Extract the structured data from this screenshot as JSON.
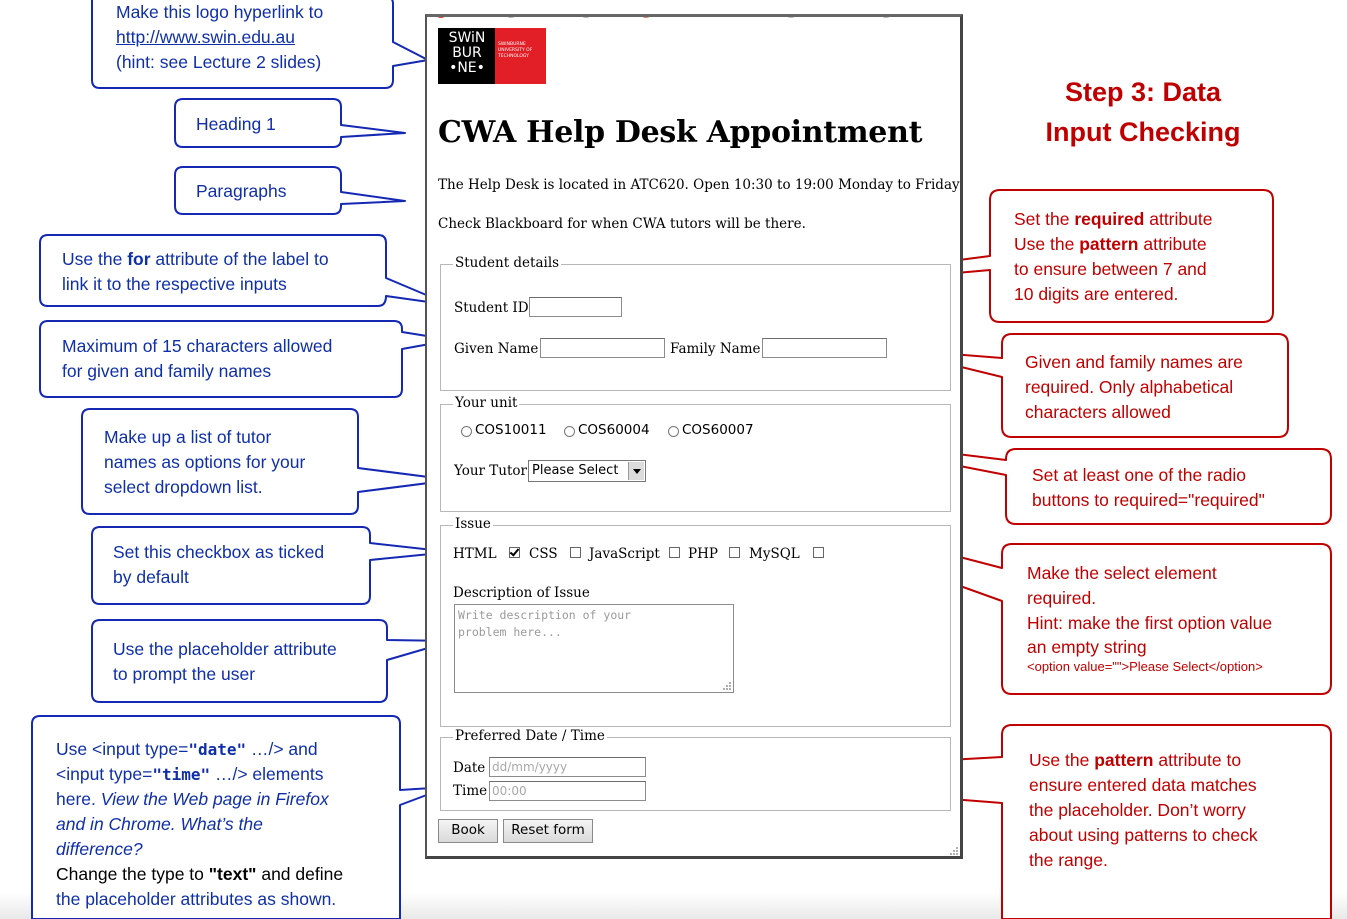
{
  "browser": {
    "logo": {
      "line1": "SWiN",
      "line2": "BUR",
      "line3": "•NE•",
      "university": [
        "SWINBURNE",
        "UNIVERSITY OF",
        "TECHNOLOGY"
      ]
    },
    "heading": "CWA Help Desk Appointment",
    "paragraph1": "The Help Desk is located in ATC620. Open 10:30 to 19:00 Monday to Friday",
    "paragraph2": "Check Blackboard for when CWA tutors will be there.",
    "student_details": {
      "legend": "Student details",
      "student_id_label": "Student ID",
      "student_id_value": "",
      "given_name_label": "Given Name",
      "given_name_value": "",
      "family_name_label": "Family Name",
      "family_name_value": ""
    },
    "your_unit": {
      "legend": "Your unit",
      "radios": [
        "COS10011",
        "COS60004",
        "COS60007"
      ],
      "tutor_label": "Your Tutor",
      "tutor_selected": "Please Select"
    },
    "issue": {
      "legend": "Issue",
      "checkboxes": [
        {
          "label": "HTML",
          "checked": true
        },
        {
          "label": "CSS",
          "checked": false
        },
        {
          "label": "JavaScript",
          "checked": false
        },
        {
          "label": "PHP",
          "checked": false
        },
        {
          "label": "MySQL",
          "checked": false
        }
      ],
      "description_label": "Description of Issue",
      "description_placeholder": "Write description of your\nproblem here..."
    },
    "preferred": {
      "legend": "Preferred Date / Time",
      "date_label": "Date",
      "date_placeholder": "dd/mm/yyyy",
      "time_label": "Time",
      "time_placeholder": "00:00"
    },
    "buttons": {
      "book": "Book",
      "reset": "Reset form"
    }
  },
  "step_title": [
    "Step 3: Data",
    "Input Checking"
  ],
  "callouts_left": {
    "logo_link": {
      "line1": "Make this logo hyperlink to",
      "url": "http://www.swin.edu.au",
      "line3": "(hint: see Lecture 2 slides)"
    },
    "heading1": "Heading 1",
    "paragraphs": "Paragraphs",
    "label_for": {
      "pre": "Use the ",
      "bold": "for",
      "post": " attribute of the label to",
      "line2": "link it to the respective inputs"
    },
    "max_chars": {
      "line1": "Maximum of 15 characters allowed",
      "line2": "for given and family names"
    },
    "tutor_list": {
      "line1": "Make up a list of tutor",
      "line2": "names as options for your",
      "line3": "select dropdown list."
    },
    "checkbox_default": {
      "line1": "Set this checkbox as ticked",
      "line2": "by default"
    },
    "placeholder": {
      "line1": "Use the placeholder attribute",
      "line2": "to prompt the user"
    },
    "date_time": {
      "l1_pre": "Use <input type=",
      "l1_bold": "\"date\"",
      "l1_post": " …/> and",
      "l2_pre": "<input type=",
      "l2_bold": "\"time\"",
      "l2_post": " …/> elements",
      "l3_pre": "here. ",
      "l3_ital": "View the Web page in Firefox",
      "l4": "and in Chrome. What’s the",
      "l5": "difference?",
      "l6_pre": " Change the type to ",
      "l6_bold": "\"text\"",
      "l6_post": " and define",
      "l7": "the placeholder attributes as shown."
    }
  },
  "callouts_right": {
    "required_pattern": {
      "l1_pre": "Set the ",
      "l1_bold": "required",
      "l1_post": " attribute",
      "l2_pre": "Use the ",
      "l2_bold": "pattern",
      "l2_post": " attribute",
      "l3": "to ensure between 7 and",
      "l4": "10 digits are entered."
    },
    "names_required": {
      "l1": "Given and family names are",
      "l2": "required. Only alphabetical",
      "l3": "characters allowed"
    },
    "radio_required": {
      "l1": "Set at least one of the radio",
      "l2": "buttons to required=\"required\""
    },
    "select_required": {
      "l1": "Make the select element",
      "l2": "required.",
      "l3": "Hint: make the first option value",
      "l4": "an empty string",
      "l5": "<option value=\"\">Please Select</option>"
    },
    "pattern_placeholder": {
      "l1_pre": "Use the ",
      "l1_bold": "pattern",
      "l1_post": " attribute to",
      "l2": "ensure entered data matches",
      "l3": "the placeholder. Don’t worry",
      "l4": "about using patterns to check",
      "l5": "the range."
    }
  }
}
